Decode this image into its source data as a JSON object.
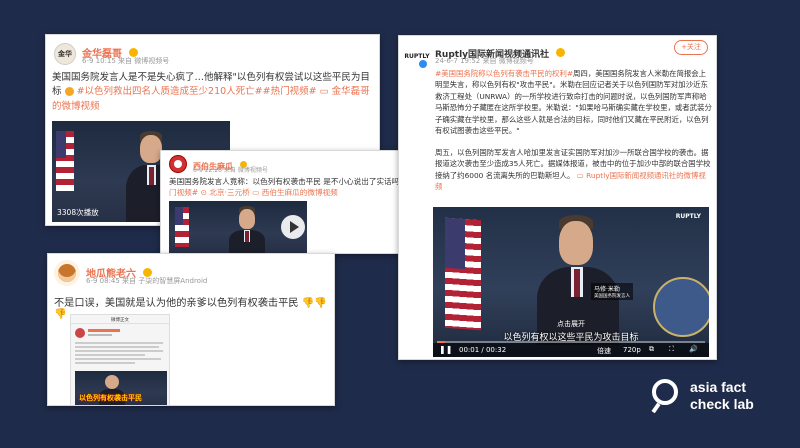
{
  "card1": {
    "user": "金华磊哥",
    "meta": "6-9 10:15 来自 微博视频号",
    "avatar_text": "金华",
    "text_a": "美国国务院发言人是不是失心疯了…他解释\"以色列有权尝试以这些平民为目标",
    "text_b": "#以色列救出四名人质造成至少210人死亡##热门视频#",
    "text_c": "金华磊哥的微博视频",
    "views": "3308次播放"
  },
  "card2": {
    "user": "西伯生麻瓜",
    "meta": "6-9 22:26 来自 微博视频号",
    "text_a": "美国国务院发言人竟称：以色列有权袭击平民 是不小心说出了实话吗",
    "tag": "#热门视频#",
    "location": "北京·三元桥",
    "video_link": "西伯生麻瓜的微博视频"
  },
  "card3": {
    "user": "地瓜熊老六",
    "meta": "6-9 08:45 来自 子柒的智慧屏Android",
    "text": "不是口误，美国就是认为他的亲爹以色列有权袭击平民",
    "inner_header": "微博正文",
    "inner_caption": "以色列有权袭击平民"
  },
  "card4": {
    "user": "Ruptly国际新闻视频通讯社",
    "meta": "24-6-7 19:52 来自 微博视频号",
    "follow": "+关注",
    "logo": "RUPTLY",
    "tag": "#美国国务院称以色列有袭击平民的权利#",
    "para1": "周四，美国国务院发言人米勒在简报会上明显失言，称以色列有权\"攻击平民\"。米勒在回应记者关于以色列国防军对加沙近东救济工程处（UNRWA）的一所学校进行致命打击的问题时说，以色列国防军声称哈马斯恐怖分子藏匿在这所学校里。米勒说：\"如果哈马斯确实藏在学校里，或者武装分子确实藏在学校里，那么这些人就是合法的目标，同时他们又藏在平民附近，以色列有权试图袭击这些平民。\"",
    "para2": "周五，以色列国防军发言人哈加里发言证实国防军对加沙一所联合国学校的袭击。据报道这次袭击至少造成35人死亡。据媒体报道，被击中的位于加沙中部的联合国学校接纳了约6000 名流离失所的巴勒斯坦人。",
    "video_link": "Ruptly国际新闻视频通讯社的微博视频",
    "video_logo": "RUPTLY",
    "nameplate": "马修·米勒",
    "nameplate_sub": "美国国务院发言人",
    "expand": "点击展开",
    "subtitle": "以色列有权以这些平民为攻击目标",
    "time": "00:01 / 00:32",
    "speed": "倍速",
    "quality": "720p"
  },
  "watermark": {
    "line1": "asia fact",
    "line2": "check lab"
  }
}
